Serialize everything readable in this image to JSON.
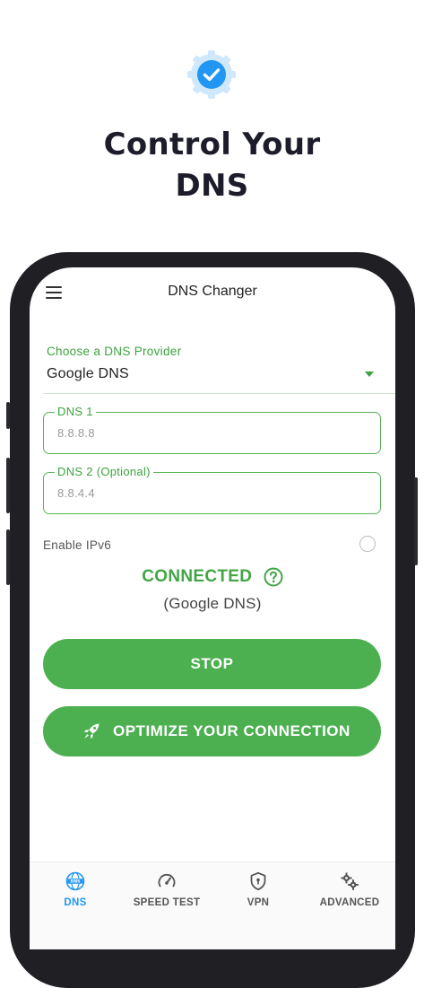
{
  "hero": {
    "title_line1": "Control Your",
    "title_line2": "DNS",
    "badge_icon": "check-gear-badge-icon",
    "badge_color": "#2196f3"
  },
  "app": {
    "title": "DNS Changer",
    "accent_color": "#4caf50"
  },
  "provider": {
    "label": "Choose a DNS Provider",
    "selected": "Google DNS"
  },
  "dns1": {
    "label": "DNS 1",
    "value": "8.8.8.8"
  },
  "dns2": {
    "label": "DNS 2 (Optional)",
    "value": "8.8.4.4"
  },
  "ipv6": {
    "label": "Enable IPv6",
    "checked": false
  },
  "status": {
    "text": "CONNECTED",
    "provider": "(Google DNS)"
  },
  "buttons": {
    "stop": "STOP",
    "optimize": "OPTIMIZE YOUR CONNECTION"
  },
  "nav": {
    "items": [
      {
        "label": "DNS",
        "icon": "dns-globe-icon",
        "active": true
      },
      {
        "label": "SPEED TEST",
        "icon": "speedometer-icon",
        "active": false
      },
      {
        "label": "VPN",
        "icon": "shield-icon",
        "active": false
      },
      {
        "label": "ADVANCED",
        "icon": "gears-icon",
        "active": false
      }
    ]
  }
}
